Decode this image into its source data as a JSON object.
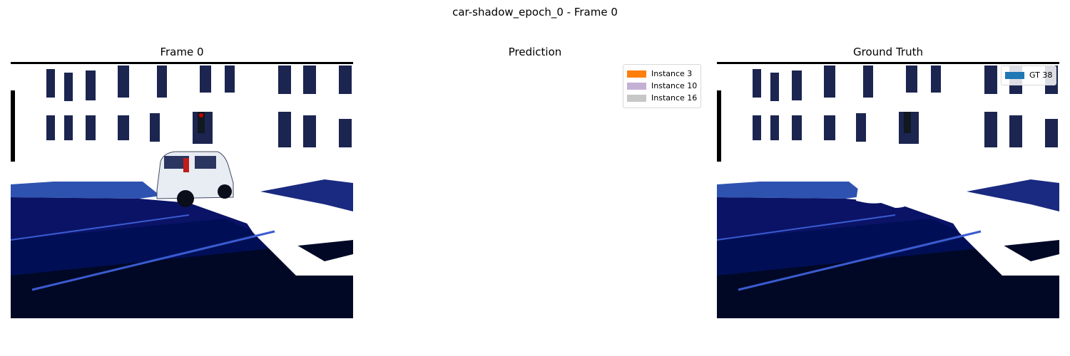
{
  "figure": {
    "title": "car-shadow_epoch_0 - Frame 0"
  },
  "panels": [
    {
      "title": "Frame 0",
      "legend": []
    },
    {
      "title": "Prediction",
      "legend": [
        {
          "label": "Instance 3",
          "color": "#ff7f0e"
        },
        {
          "label": "Instance 10",
          "color": "#c5b0d5"
        },
        {
          "label": "Instance 16",
          "color": "#c7c7c7"
        }
      ]
    },
    {
      "title": "Ground Truth",
      "legend": [
        {
          "label": "GT 38",
          "color": "#1f77b4"
        }
      ]
    }
  ]
}
